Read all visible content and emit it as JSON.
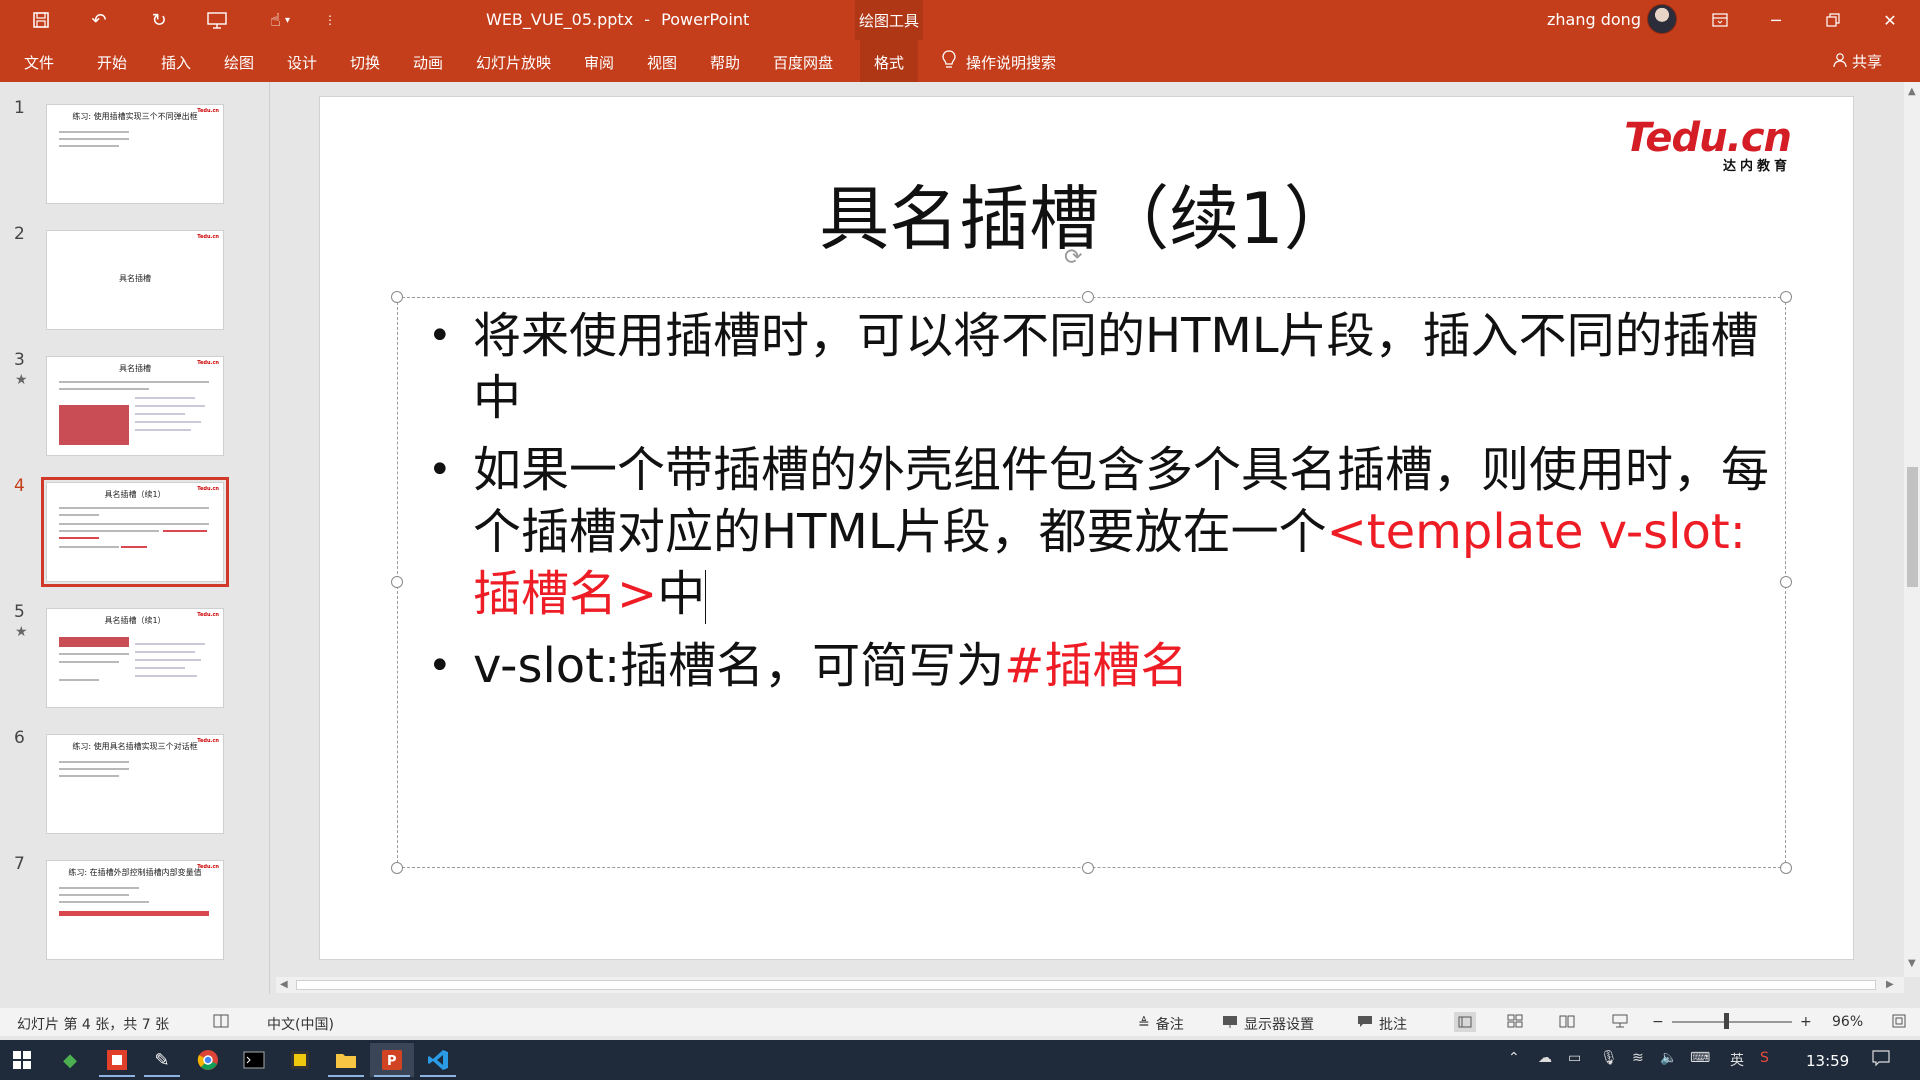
{
  "titlebar": {
    "filename": "WEB_VUE_05.pptx",
    "separator": "-",
    "app": "PowerPoint",
    "context_tab": "绘图工具",
    "user": "zhang dong",
    "accent": "#c43e1c"
  },
  "ribbon": {
    "tabs": [
      "文件",
      "开始",
      "插入",
      "绘图",
      "设计",
      "切换",
      "动画",
      "幻灯片放映",
      "审阅",
      "视图",
      "帮助",
      "百度网盘",
      "格式"
    ],
    "tell_me": "操作说明搜索",
    "share": "共享"
  },
  "thumbnails": [
    {
      "num": "1",
      "title": "练习: 使用插槽实现三个不同弹出框",
      "star": false
    },
    {
      "num": "2",
      "title": "具名插槽",
      "star": false
    },
    {
      "num": "3",
      "title": "具名插槽",
      "star": true
    },
    {
      "num": "4",
      "title": "具名插槽（续1）",
      "star": false
    },
    {
      "num": "5",
      "title": "具名插槽（续1）",
      "star": true
    },
    {
      "num": "6",
      "title": "练习: 使用具名插槽实现三个对话框",
      "star": false
    },
    {
      "num": "7",
      "title": "练习: 在插槽外部控制插槽内部变量值",
      "star": false
    }
  ],
  "slide": {
    "logo_main": "Tedu.cn",
    "logo_sub": "达内教育",
    "title": "具名插槽（续1）",
    "bullets": [
      {
        "text": "将来使用插槽时，可以将不同的HTML片段，插入不同的插槽中"
      },
      {
        "text_before": "如果一个带插槽的外壳组件包含多个具名插槽，则使用时，每个插槽对应的HTML片段，都要放在一个",
        "red": "<template v-slot:插槽名>",
        "text_after": "中"
      },
      {
        "text_before": "v-slot:插槽名，可简写为",
        "red": "#插槽名"
      }
    ],
    "red_color": "#ee1c25"
  },
  "statusbar": {
    "slide_info": "幻灯片 第 4 张，共 7 张",
    "language": "中文(中国)",
    "notes": "备注",
    "display_settings": "显示器设置",
    "comments": "批注",
    "zoom": "96%"
  },
  "taskbar": {
    "time": "13:59"
  }
}
